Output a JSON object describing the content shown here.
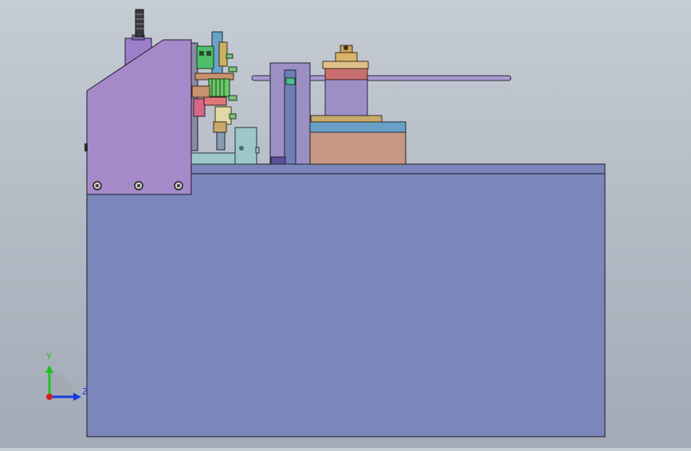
{
  "viewport": {
    "background_top": "#c6ccd4",
    "background_bottom": "#a2aab6"
  },
  "model": {
    "base_color": "#7b86bb",
    "side_plate_color": "#a589c8",
    "drum_color": "#c89784",
    "drum_cap_color": "#6aa0c8",
    "column_color": "#9c8fc4",
    "bracket_color": "#9ec7c9"
  },
  "triad": {
    "y_label": "Y",
    "z_label": "Z",
    "y_color": "#22c222",
    "z_color": "#1a3adf",
    "x_color": "#d32020"
  }
}
